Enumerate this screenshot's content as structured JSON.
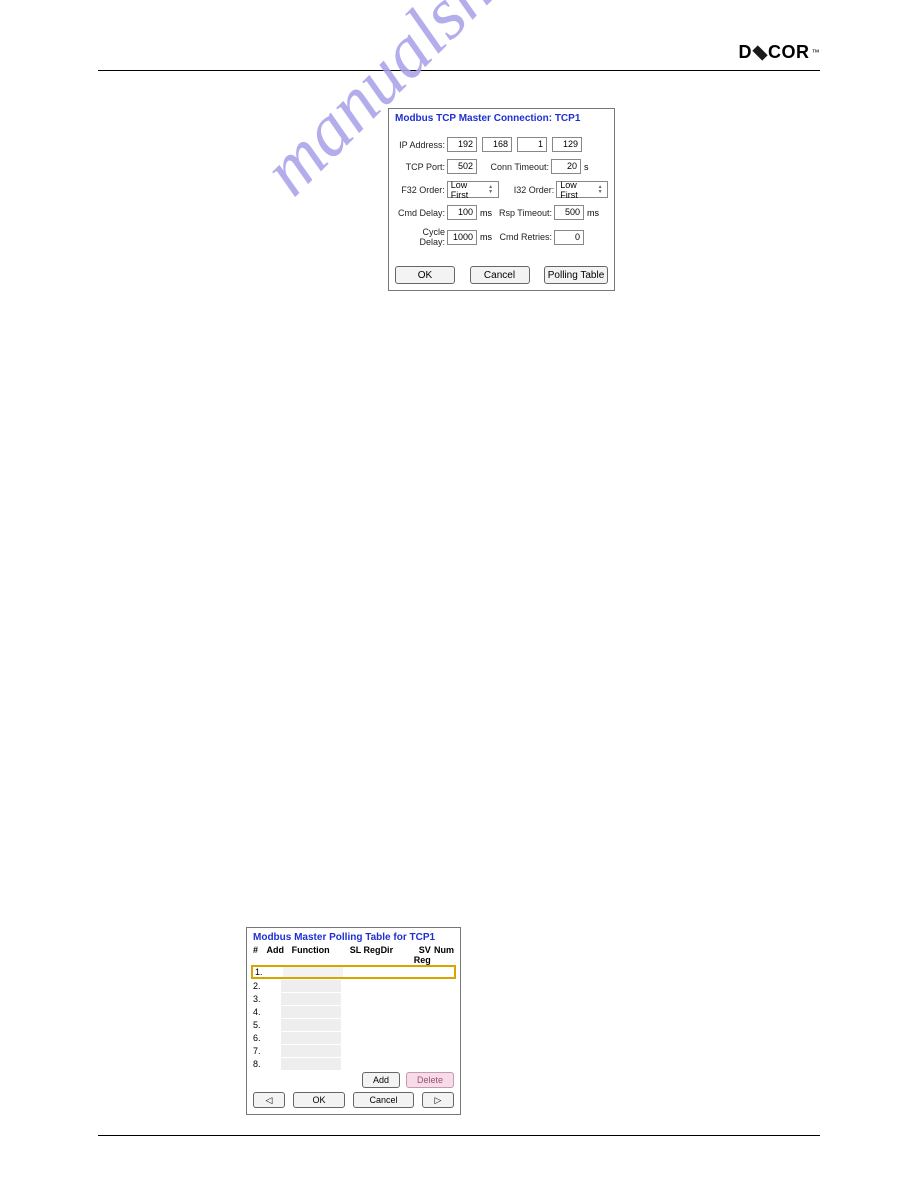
{
  "brand": {
    "name_part1": "D",
    "name_part2": "COR"
  },
  "watermark": "manualshive.com",
  "dlg1": {
    "title": "Modbus TCP Master Connection: TCP1",
    "labels": {
      "ip": "IP Address:",
      "tcp_port": "TCP Port:",
      "conn_timeout": "Conn Timeout:",
      "f32_order": "F32 Order:",
      "i32_order": "I32 Order:",
      "cmd_delay": "Cmd Delay:",
      "rsp_timeout": "Rsp Timeout:",
      "cycle_delay": "Cycle Delay:",
      "cmd_retries": "Cmd Retries:"
    },
    "values": {
      "ip1": "192",
      "ip2": "168",
      "ip3": "1",
      "ip4": "129",
      "tcp_port": "502",
      "conn_timeout": "20",
      "f32_order": "Low First",
      "i32_order": "Low First",
      "cmd_delay": "100",
      "rsp_timeout": "500",
      "cycle_delay": "1000",
      "cmd_retries": "0"
    },
    "units": {
      "s": "s",
      "ms": "ms"
    },
    "buttons": {
      "ok": "OK",
      "cancel": "Cancel",
      "polling": "Polling Table"
    }
  },
  "dlg2": {
    "title": "Modbus Master Polling Table for TCP1",
    "headers": {
      "num": "#",
      "add": "Add",
      "func": "Function",
      "slreg": "SL Reg",
      "dir": "Dir",
      "svreg": "SV Reg",
      "numr": "Num"
    },
    "rows": [
      "1.",
      "2.",
      "3.",
      "4.",
      "5.",
      "6.",
      "7.",
      "8."
    ],
    "buttons": {
      "add": "Add",
      "delete": "Delete",
      "ok": "OK",
      "cancel": "Cancel",
      "prev": "◁",
      "next": "▷"
    }
  }
}
